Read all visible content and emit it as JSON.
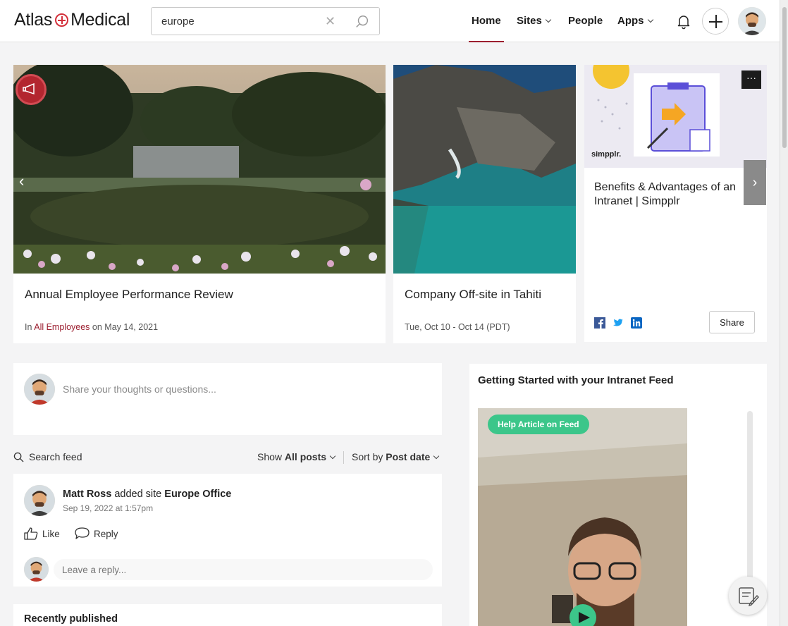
{
  "brand": {
    "name_left": "Atlas",
    "name_right": "Medical"
  },
  "search": {
    "value": "europe"
  },
  "nav": {
    "home": "Home",
    "sites": "Sites",
    "people": "People",
    "apps": "Apps",
    "active": "Home"
  },
  "carousel": {
    "cards": [
      {
        "title": "Annual Employee Performance Review",
        "meta_prefix": "In",
        "meta_link": "All Employees",
        "meta_suffix": "on May 14, 2021"
      },
      {
        "title": "Company Off-site in Tahiti",
        "meta": "Tue, Oct 10 - Oct 14 (PDT)"
      },
      {
        "title": "Benefits & Advantages of an Intranet | Simpplr",
        "image_caption": "simpplr.",
        "share_label": "Share",
        "social_icons": [
          "facebook-icon",
          "twitter-icon",
          "linkedin-icon"
        ]
      }
    ]
  },
  "composer": {
    "placeholder": "Share your thoughts or questions..."
  },
  "feed_bar": {
    "search_label": "Search feed",
    "show_prefix": "Show",
    "show_value": "All posts",
    "sort_prefix": "Sort by",
    "sort_value": "Post date"
  },
  "post": {
    "author": "Matt Ross",
    "action": "added site",
    "site": "Europe Office",
    "timestamp": "Sep 19, 2022 at 1:57pm",
    "like_label": "Like",
    "reply_label": "Reply",
    "reply_placeholder": "Leave a reply..."
  },
  "recently_published": {
    "heading": "Recently published"
  },
  "side_panel": {
    "title": "Getting Started with your Intranet Feed",
    "badge": "Help Article on Feed"
  },
  "colors": {
    "accent": "#9c1f30",
    "logo_red": "#d32f3a",
    "badge_green": "#3cc68a"
  }
}
